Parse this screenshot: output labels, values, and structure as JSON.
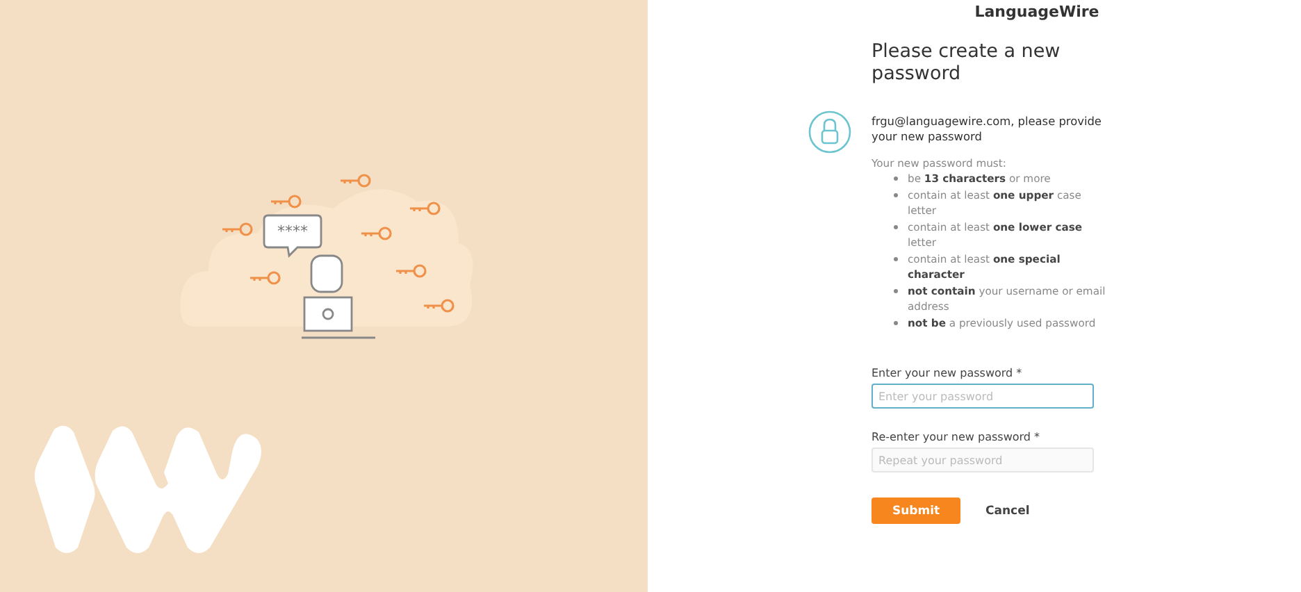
{
  "illustration": {
    "bubble_text": "****"
  },
  "logo": {
    "text": "LanguageWire"
  },
  "heading": "Please create a new password",
  "intro": "frgu@languagewire.com, please provide your new password",
  "rules_title": "Your new password must:",
  "rules": [
    "be **13 characters** or more",
    "contain at least **one upper** case letter",
    "contain at least **one lower case** letter",
    "contain at least **one special character**",
    "**not contain** your username or email address",
    "**not be** a previously used password"
  ],
  "fields": [
    {
      "label": "Enter your new password *",
      "placeholder": "Enter your password",
      "focused": true
    },
    {
      "label": "Re-enter your new password *",
      "placeholder": "Repeat your password",
      "focused": false
    }
  ],
  "buttons": [
    {
      "label": "Submit",
      "kind": "primary"
    },
    {
      "label": "Cancel",
      "kind": "link"
    }
  ]
}
